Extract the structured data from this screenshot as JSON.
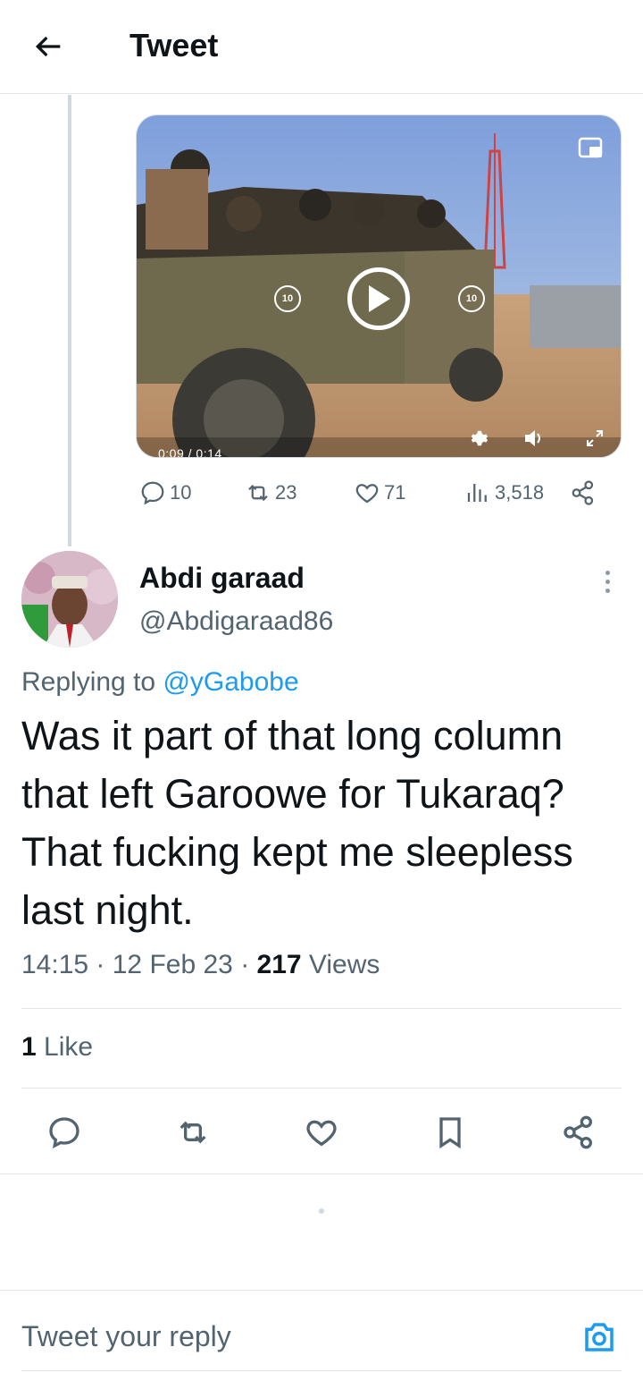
{
  "header": {
    "title": "Tweet"
  },
  "video": {
    "time": "0:09 / 0:14",
    "skip_back": "10",
    "skip_forward": "10"
  },
  "quoted_stats": {
    "replies": "10",
    "retweets": "23",
    "likes": "71",
    "views": "3,518"
  },
  "author": {
    "display_name": "Abdi garaad",
    "handle": "@Abdigaraad86"
  },
  "reply": {
    "prefix": "Replying to ",
    "target": "@yGabobe",
    "text": "Was it part of that long column that left Garoowe for Tukaraq? That fucking kept me sleepless last night.",
    "time": "14:15",
    "date": "12 Feb 23",
    "views_count": "217",
    "views_label": " Views",
    "likes_count": "1",
    "likes_label": " Like"
  },
  "composer": {
    "placeholder": "Tweet your reply"
  },
  "colors": {
    "accent": "#1d9bf0",
    "text": "#0f1419",
    "secondary": "#536471",
    "divider": "#e1e6ea"
  }
}
